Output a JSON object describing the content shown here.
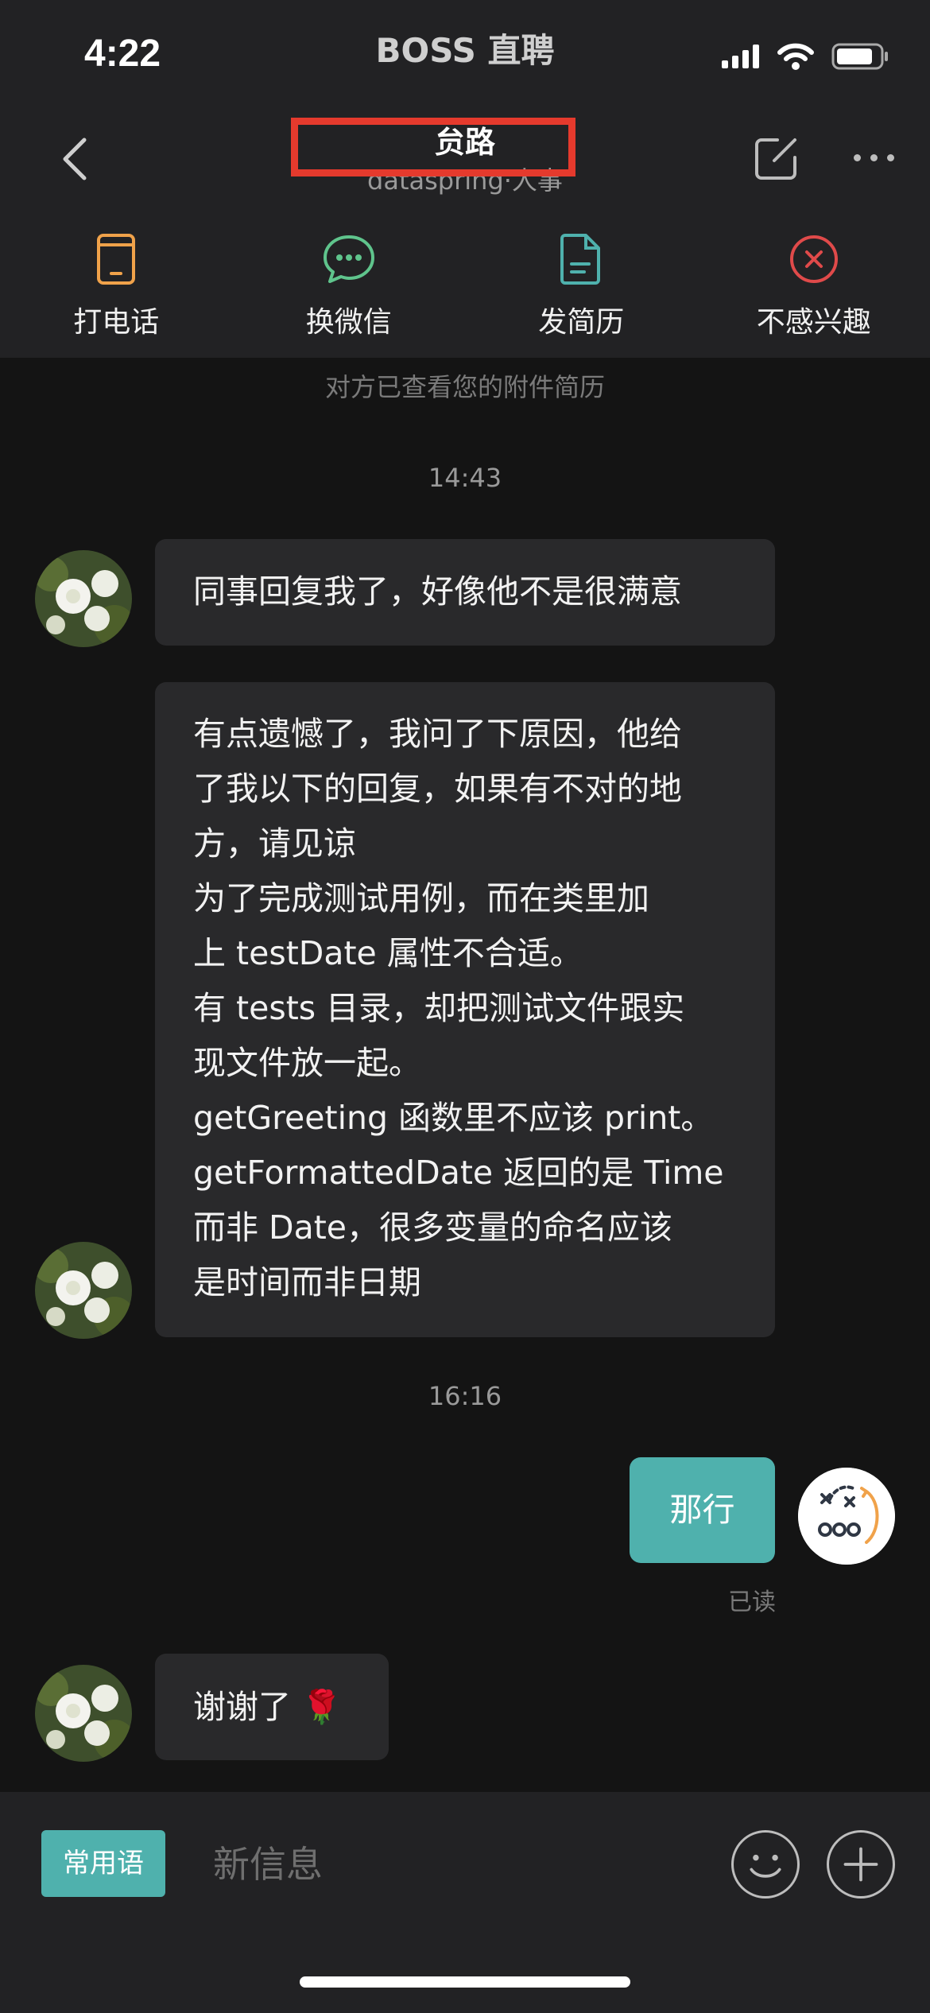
{
  "status_bar": {
    "time": "4:22",
    "app_name": "BOSS 直聘"
  },
  "header": {
    "contact_name": "贠路",
    "company_role": "dataspring·人事",
    "redaction_color": "#e53a2d"
  },
  "actions": [
    {
      "label": "打电话",
      "icon": "phone-icon",
      "color": "#f0a24a"
    },
    {
      "label": "换微信",
      "icon": "wechat-icon",
      "color": "#5fc48c"
    },
    {
      "label": "发简历",
      "icon": "resume-file-icon",
      "color": "#4fb1ad"
    },
    {
      "label": "不感兴趣",
      "icon": "close-circle-icon",
      "color": "#e04a4a"
    }
  ],
  "chat": {
    "system_note": "对方已查看您的附件简历",
    "timestamps": [
      "14:43",
      "16:16"
    ],
    "messages": [
      {
        "from": "them",
        "lines": [
          "同事回复我了，好像他不是很满意"
        ]
      },
      {
        "from": "them",
        "lines": [
          "有点遗憾了，我问了下原因，他给",
          "了我以下的回复，如果有不对的地",
          "方，请见谅",
          "为了完成测试用例，而在类里加",
          "上 testDate 属性不合适。",
          "有 tests 目录，却把测试文件跟实",
          "现文件放一起。",
          "getGreeting 函数里不应该 print。",
          "getFormattedDate 返回的是 Time",
          "而非 Date，很多变量的命名应该",
          "是时间而非日期"
        ]
      },
      {
        "from": "me",
        "text": "那行",
        "status": "已读"
      },
      {
        "from": "them",
        "text": "谢谢了",
        "emoji": "🌹"
      }
    ]
  },
  "input": {
    "phrases_label": "常用语",
    "placeholder": "新信息"
  },
  "colors": {
    "accent": "#4fb1ad",
    "background": "#141414",
    "bar": "#222224",
    "bubble": "#29292b"
  }
}
